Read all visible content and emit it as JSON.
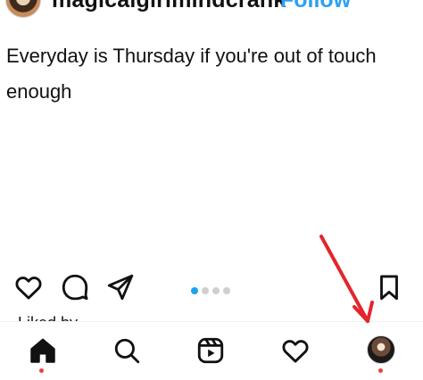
{
  "header": {
    "username": "magicalgirlmindcrank",
    "follow_label": "Follow"
  },
  "post": {
    "text": "Everyday is Thursday if you're out of touch enough"
  },
  "caption": {
    "text": "Liked by ..."
  },
  "colors": {
    "accent": "#1da1f2",
    "notification_dot": "#ef3f3f",
    "arrow": "#e3262b"
  },
  "icons": {
    "like": "heart-icon",
    "comment": "comment-icon",
    "share": "send-icon",
    "save": "bookmark-icon",
    "home": "home-icon",
    "search": "search-icon",
    "reels": "reels-icon",
    "activity": "heart-icon",
    "profile": "profile-avatar"
  },
  "carousel": {
    "total": 4,
    "active_index": 1
  }
}
